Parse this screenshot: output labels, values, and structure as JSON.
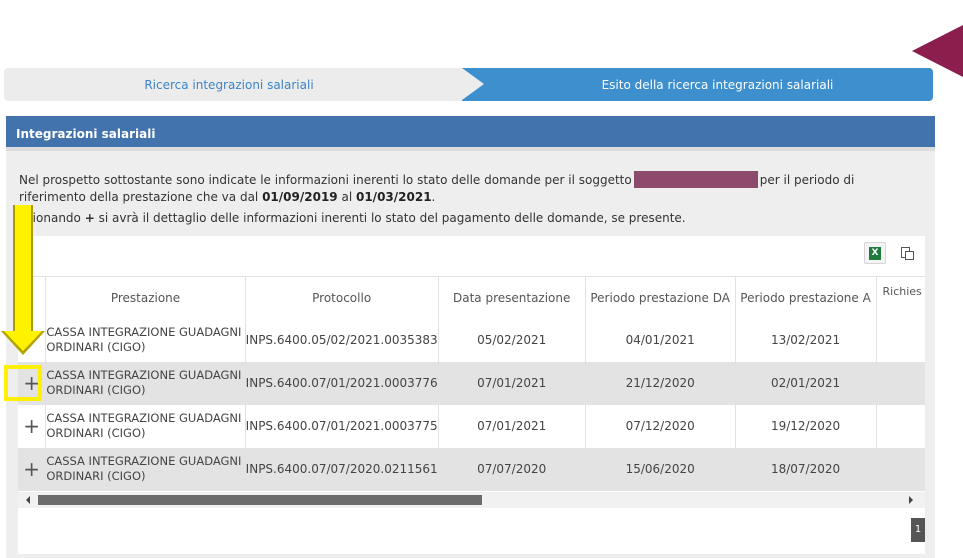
{
  "steps": {
    "step1": "Ricerca integrazioni salariali",
    "step2": "Esito della ricerca integrazioni salariali"
  },
  "panel": {
    "title": "Integrazioni salariali",
    "intro_part1": "Nel prospetto sottostante sono indicate le informazioni inerenti lo stato delle domande per il soggetto",
    "intro_part2": "per il periodo di riferimento della prestazione che va dal",
    "date_from": "01/09/2019",
    "intro_part3": "al",
    "date_to": "01/03/2021",
    "intro_end": ".",
    "note_prefix": "ezionando",
    "note_plus": "+",
    "note_rest": "si avrà il dettaglio delle informazioni inerenti lo stato del pagamento delle domande, se presente."
  },
  "toolbar": {
    "excel_icon": "excel-icon",
    "excel_glyph": "X",
    "copy_icon": "copy-icon"
  },
  "table": {
    "headers": [
      "Prestazione",
      "Protocollo",
      "Data presentazione",
      "Periodo prestazione DA",
      "Periodo prestazione A",
      "Richies"
    ],
    "rows": [
      {
        "plus": "",
        "prestazione": "CASSA INTEGRAZIONE GUADAGNI ORDINARI (CIGO)",
        "protocollo": "INPS.6400.05/02/2021.0035383",
        "data": "05/02/2021",
        "da": "04/01/2021",
        "a": "13/02/2021"
      },
      {
        "plus": "+",
        "prestazione": "CASSA INTEGRAZIONE GUADAGNI ORDINARI (CIGO)",
        "protocollo": "INPS.6400.07/01/2021.0003776",
        "data": "07/01/2021",
        "da": "21/12/2020",
        "a": "02/01/2021"
      },
      {
        "plus": "+",
        "prestazione": "CASSA INTEGRAZIONE GUADAGNI ORDINARI (CIGO)",
        "protocollo": "INPS.6400.07/01/2021.0003775",
        "data": "07/01/2021",
        "da": "07/12/2020",
        "a": "19/12/2020"
      },
      {
        "plus": "+",
        "prestazione": "CASSA INTEGRAZIONE GUADAGNI ORDINARI (CIGO)",
        "protocollo": "INPS.6400.07/07/2020.0211561",
        "data": "07/07/2020",
        "da": "15/06/2020",
        "a": "18/07/2020"
      }
    ]
  },
  "pager": {
    "page": "1"
  },
  "colors": {
    "header_blue": "#4273ac",
    "step_blue": "#3d8fce",
    "annotation_yellow": "#fff200",
    "brand_triangle": "#8b1e4d"
  }
}
